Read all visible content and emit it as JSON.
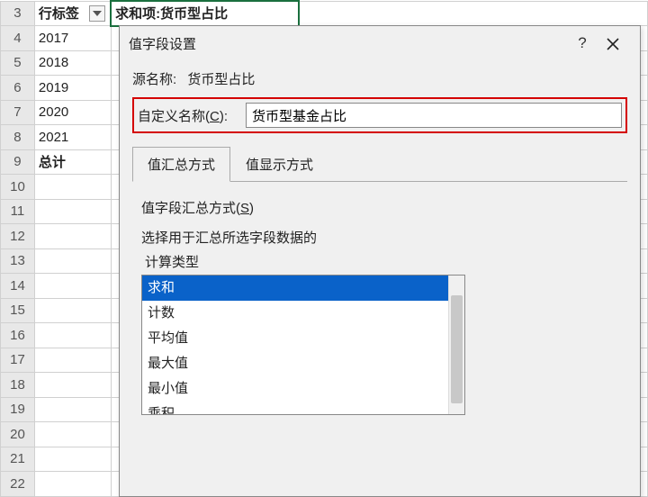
{
  "sheet": {
    "rows": [
      {
        "num": "3",
        "a": "行标签",
        "b": "求和项:货币型占比",
        "isHeader": true
      },
      {
        "num": "4",
        "a": "2017",
        "b": ""
      },
      {
        "num": "5",
        "a": "2018",
        "b": ""
      },
      {
        "num": "6",
        "a": "2019",
        "b": ""
      },
      {
        "num": "7",
        "a": "2020",
        "b": ""
      },
      {
        "num": "8",
        "a": "2021",
        "b": ""
      },
      {
        "num": "9",
        "a": "总计",
        "b": "",
        "bold": true
      },
      {
        "num": "10",
        "a": "",
        "b": ""
      },
      {
        "num": "11",
        "a": "",
        "b": ""
      },
      {
        "num": "12",
        "a": "",
        "b": ""
      },
      {
        "num": "13",
        "a": "",
        "b": ""
      },
      {
        "num": "14",
        "a": "",
        "b": ""
      },
      {
        "num": "15",
        "a": "",
        "b": ""
      },
      {
        "num": "16",
        "a": "",
        "b": ""
      },
      {
        "num": "17",
        "a": "",
        "b": ""
      },
      {
        "num": "18",
        "a": "",
        "b": ""
      },
      {
        "num": "19",
        "a": "",
        "b": ""
      },
      {
        "num": "20",
        "a": "",
        "b": ""
      },
      {
        "num": "21",
        "a": "",
        "b": ""
      },
      {
        "num": "22",
        "a": "",
        "b": ""
      }
    ]
  },
  "dialog": {
    "title": "值字段设置",
    "help": "?",
    "source_label": "源名称:",
    "source_value": "货币型占比",
    "custom_label_pre": "自定义名称(",
    "custom_label_u": "C",
    "custom_label_post": "):",
    "custom_value": "货币型基金占比",
    "tabs": {
      "summary": "值汇总方式",
      "display": "值显示方式"
    },
    "summary_label_pre": "值字段汇总方式(",
    "summary_label_u": "S",
    "summary_label_post": ")",
    "summary_desc": "选择用于汇总所选字段数据的",
    "calc_type_label": "计算类型",
    "calc_types": [
      "求和",
      "计数",
      "平均值",
      "最大值",
      "最小值",
      "乘积"
    ],
    "selected_calc": "求和"
  }
}
